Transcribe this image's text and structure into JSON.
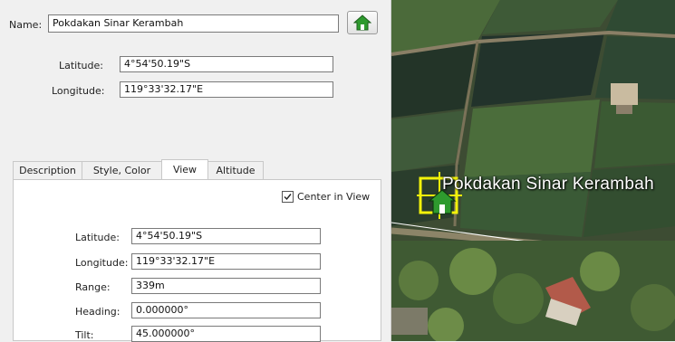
{
  "form": {
    "name_label": "Name:",
    "name_value": "Pokdakan Sinar Kerambah",
    "latitude_label": "Latitude:",
    "latitude_value": "4°54'50.19\"S",
    "longitude_label": "Longitude:",
    "longitude_value": "119°33'32.17\"E",
    "icon_button": "house-icon"
  },
  "tabs": [
    {
      "label": "Description"
    },
    {
      "label": "Style, Color"
    },
    {
      "label": "View"
    },
    {
      "label": "Altitude"
    }
  ],
  "view": {
    "center_label": "Center in View",
    "center_checked": true,
    "latitude_label": "Latitude:",
    "latitude_value": "4°54'50.19\"S",
    "longitude_label": "Longitude:",
    "longitude_value": "119°33'32.17\"E",
    "range_label": "Range:",
    "range_value": "339m",
    "heading_label": "Heading:",
    "heading_value": "0.000000°",
    "tilt_label": "Tilt:",
    "tilt_value": "45.000000°"
  },
  "map": {
    "placemark_label": "Pokdakan Sinar Kerambah",
    "placemark_icon": "house-icon",
    "highlight_color": "#f2f20a",
    "house_color": "#2e9a2e"
  }
}
